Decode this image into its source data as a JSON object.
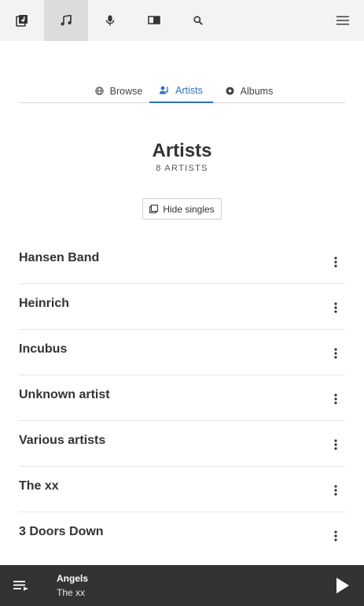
{
  "topnav": {
    "items": [
      {
        "name": "library-icon",
        "active": false
      },
      {
        "name": "music-note-icon",
        "active": true
      },
      {
        "name": "microphone-icon",
        "active": false
      },
      {
        "name": "book-icon",
        "active": false
      },
      {
        "name": "search-icon",
        "active": false
      }
    ],
    "menu_icon": "hamburger-menu-icon"
  },
  "tabs": [
    {
      "label": "Browse",
      "icon": "globe-icon",
      "active": false
    },
    {
      "label": "Artists",
      "icon": "artist-icon",
      "active": true
    },
    {
      "label": "Albums",
      "icon": "disc-icon",
      "active": false
    }
  ],
  "page": {
    "title": "Artists",
    "count": "8 ARTISTS",
    "hide_singles_label": "Hide singles"
  },
  "artists": [
    "Hansen Band",
    "Heinrich",
    "Incubus",
    "Unknown artist",
    "Various artists",
    "The xx",
    "3 Doors Down"
  ],
  "player": {
    "title": "Angels",
    "artist": "The xx"
  },
  "colors": {
    "accent": "#2f6fc4",
    "topbar": "#f3f3f3",
    "player_bg": "#333333"
  }
}
